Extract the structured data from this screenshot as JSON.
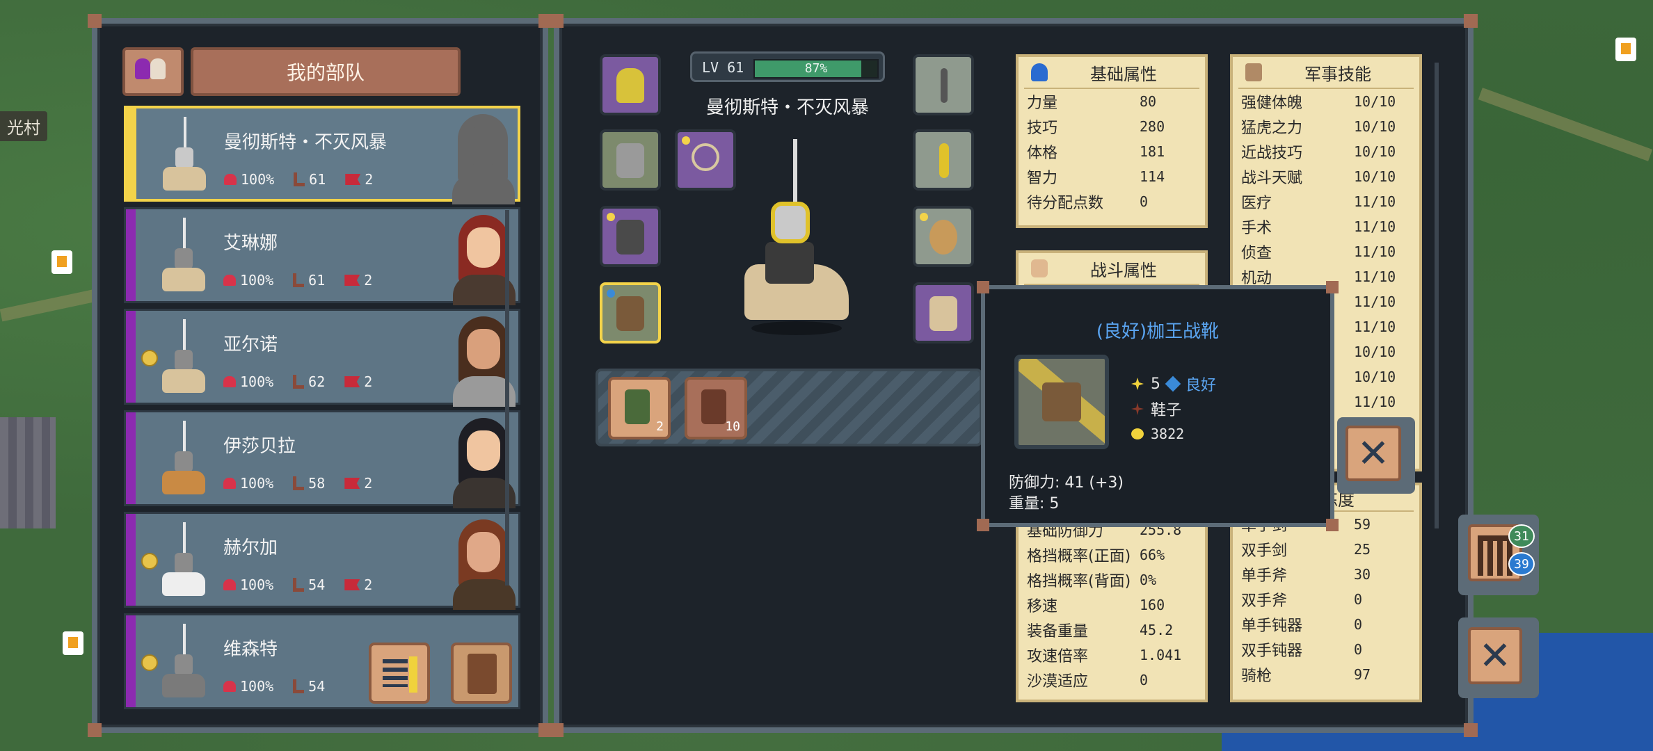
{
  "map": {
    "village_label": "光村"
  },
  "party": {
    "title": "我的部队",
    "units": [
      {
        "name": "曼彻斯特・不灭风暴",
        "hp": "100%",
        "level": "61",
        "troops": "2",
        "selected": true
      },
      {
        "name": "艾琳娜",
        "hp": "100%",
        "level": "61",
        "troops": "2"
      },
      {
        "name": "亚尔诺",
        "hp": "100%",
        "level": "62",
        "troops": "2"
      },
      {
        "name": "伊莎贝拉",
        "hp": "100%",
        "level": "58",
        "troops": "2"
      },
      {
        "name": "赫尔加",
        "hp": "100%",
        "level": "54",
        "troops": "2"
      },
      {
        "name": "维森特",
        "hp": "100%",
        "level": "54",
        "troops": ""
      }
    ]
  },
  "hero": {
    "level_label": "LV 61",
    "exp_text": "87%",
    "exp_fraction": 0.87,
    "name": "曼彻斯特・不灭风暴"
  },
  "bag": {
    "items": [
      {
        "count": "2"
      },
      {
        "count": "10"
      }
    ]
  },
  "basic_attributes": {
    "title": "基础属性",
    "rows": [
      {
        "k": "力量",
        "v": "80"
      },
      {
        "k": "技巧",
        "v": "280"
      },
      {
        "k": "体格",
        "v": "181"
      },
      {
        "k": "智力",
        "v": "114"
      },
      {
        "k": "待分配点数",
        "v": "0"
      }
    ]
  },
  "combat_attributes": {
    "title": "战斗属性",
    "rows_visible": [
      {
        "k": "基础防御力",
        "v": "255.8"
      },
      {
        "k": "格挡概率(正面)",
        "v": "66%"
      },
      {
        "k": "格挡概率(背面)",
        "v": "0%"
      },
      {
        "k": "移速",
        "v": "160"
      },
      {
        "k": "装备重量",
        "v": "45.2"
      },
      {
        "k": "攻速倍率",
        "v": "1.041"
      },
      {
        "k": "沙漠适应",
        "v": "0"
      }
    ]
  },
  "military_skills": {
    "title": "军事技能",
    "rows": [
      {
        "k": "强健体魄",
        "v": "10/10"
      },
      {
        "k": "猛虎之力",
        "v": "10/10"
      },
      {
        "k": "近战技巧",
        "v": "10/10"
      },
      {
        "k": "战斗天赋",
        "v": "10/10"
      },
      {
        "k": "医疗",
        "v": "11/10"
      },
      {
        "k": "手术",
        "v": "11/10"
      },
      {
        "k": "侦查",
        "v": "11/10"
      },
      {
        "k": "机动",
        "v": "11/10"
      },
      {
        "k": "",
        "v": "11/10"
      },
      {
        "k": "",
        "v": "11/10"
      },
      {
        "k": "",
        "v": "10/10"
      },
      {
        "k": "",
        "v": "10/10"
      },
      {
        "k": "",
        "v": "11/10"
      }
    ]
  },
  "proficiency": {
    "title": "熟练度",
    "rows": [
      {
        "k": "单手剑",
        "v": "59"
      },
      {
        "k": "双手剑",
        "v": "25"
      },
      {
        "k": "单手斧",
        "v": "30"
      },
      {
        "k": "双手斧",
        "v": "0"
      },
      {
        "k": "单手钝器",
        "v": "0"
      },
      {
        "k": "双手钝器",
        "v": "0"
      },
      {
        "k": "骑枪",
        "v": "97"
      }
    ]
  },
  "tooltip": {
    "title": "(良好)枷王战靴",
    "tier": "5",
    "quality": "良好",
    "type": "鞋子",
    "price": "3822",
    "defense": "防御力: 41 (+3)",
    "weight": "重量: 5"
  },
  "side": {
    "badge_top": "31",
    "badge_bottom": "39"
  },
  "colors": {
    "accent_gold": "#f3d34a",
    "quality_blue": "#5aa4f0",
    "panel_bg": "#1d232a",
    "parchment": "#f1e3b5"
  }
}
